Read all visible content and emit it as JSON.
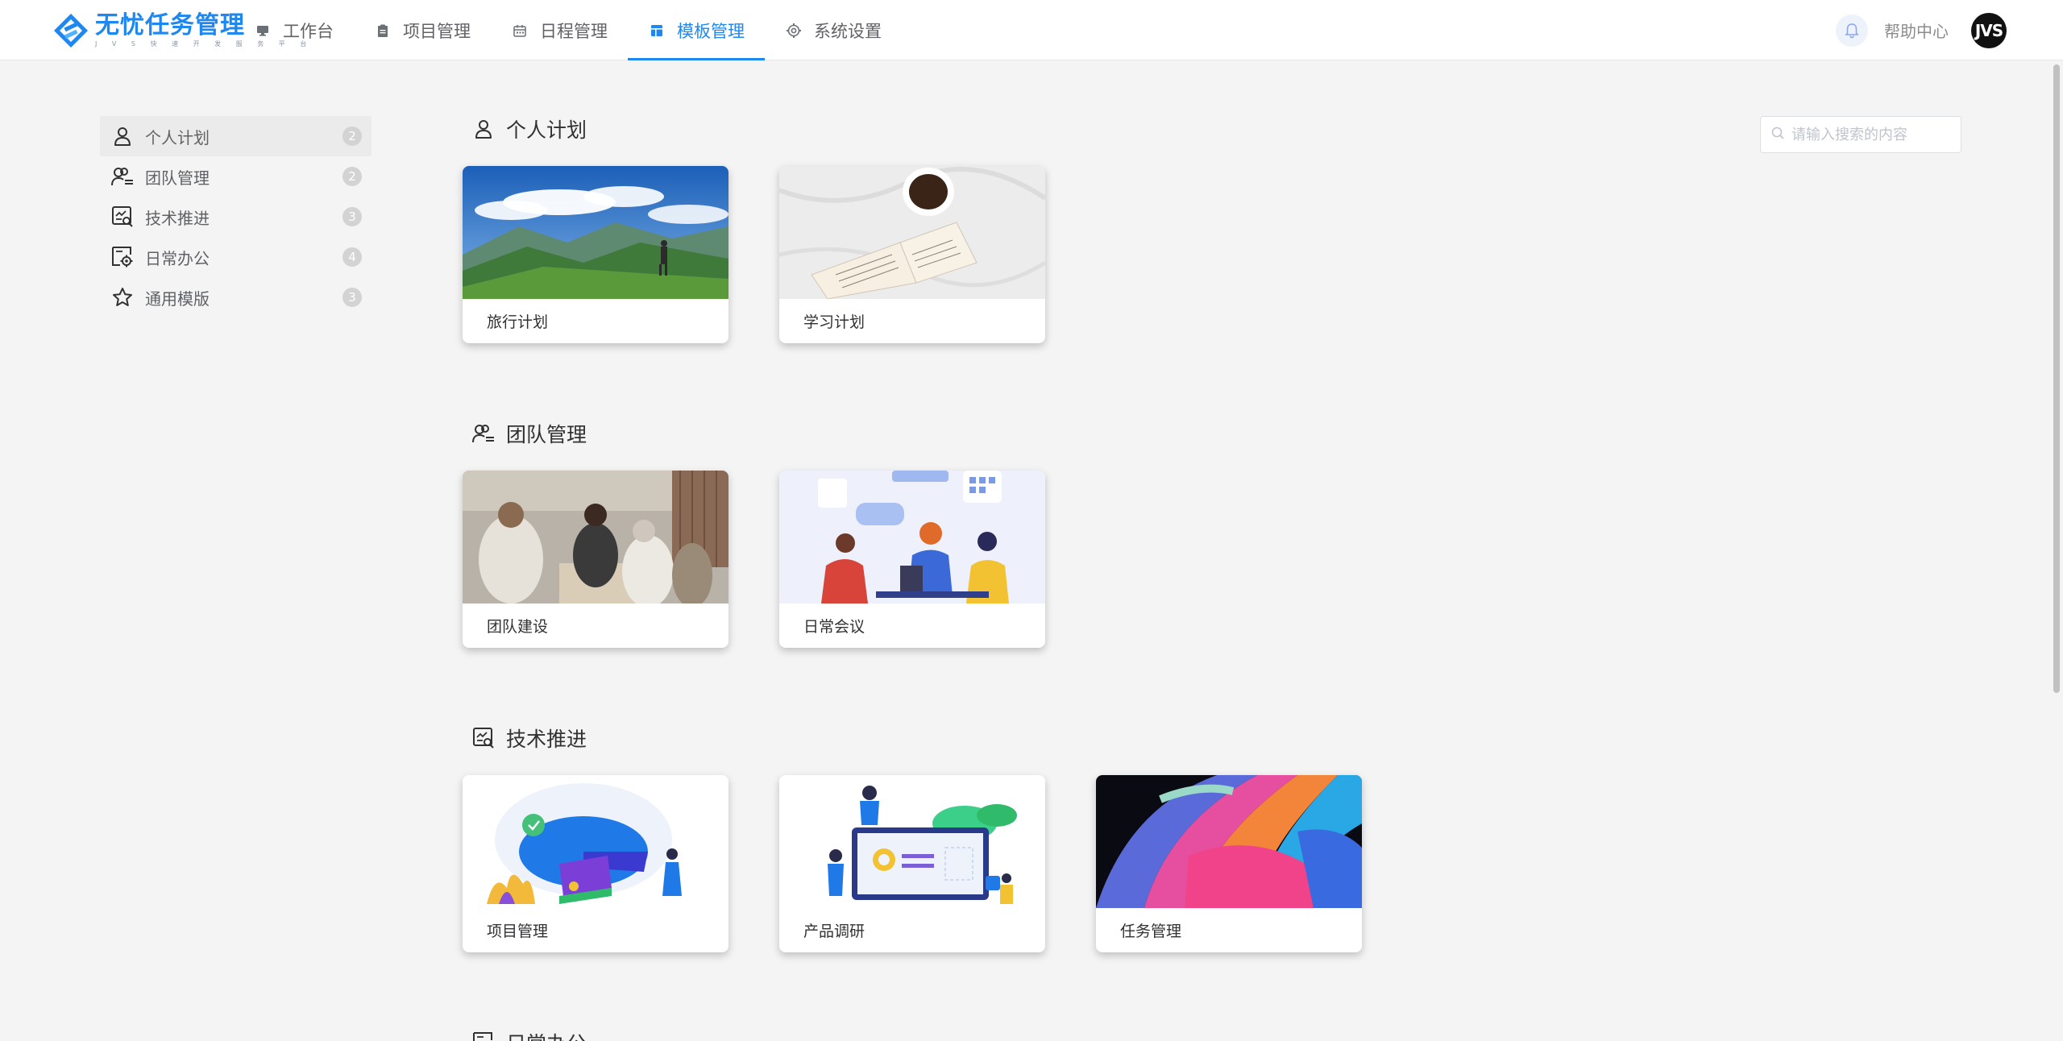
{
  "app": {
    "logo_title": "无忧任务管理",
    "logo_sub": "J V S 快 速 开 发 服 务 平 台"
  },
  "nav": [
    {
      "label": "工作台",
      "icon": "monitor-icon",
      "active": false
    },
    {
      "label": "项目管理",
      "icon": "clipboard-icon",
      "active": false
    },
    {
      "label": "日程管理",
      "icon": "calendar-icon",
      "active": false
    },
    {
      "label": "模板管理",
      "icon": "template-icon",
      "active": true
    },
    {
      "label": "系统设置",
      "icon": "gear-icon",
      "active": false
    }
  ],
  "header_right": {
    "help": "帮助中心",
    "avatar": "JVS"
  },
  "sidebar": {
    "items": [
      {
        "label": "个人计划",
        "count": "2",
        "icon": "person-icon",
        "active": true
      },
      {
        "label": "团队管理",
        "count": "2",
        "icon": "team-icon",
        "active": false
      },
      {
        "label": "技术推进",
        "count": "3",
        "icon": "tech-icon",
        "active": false
      },
      {
        "label": "日常办公",
        "count": "4",
        "icon": "office-icon",
        "active": false
      },
      {
        "label": "通用模版",
        "count": "3",
        "icon": "star-icon",
        "active": false
      }
    ]
  },
  "search": {
    "placeholder": "请输入搜索的内容"
  },
  "sections": [
    {
      "title": "个人计划",
      "icon": "person-icon",
      "cards": [
        {
          "label": "旅行计划"
        },
        {
          "label": "学习计划"
        }
      ]
    },
    {
      "title": "团队管理",
      "icon": "team-icon",
      "cards": [
        {
          "label": "团队建设"
        },
        {
          "label": "日常会议"
        }
      ]
    },
    {
      "title": "技术推进",
      "icon": "tech-icon",
      "cards": [
        {
          "label": "项目管理"
        },
        {
          "label": "产品调研"
        },
        {
          "label": "任务管理"
        }
      ]
    },
    {
      "title": "日常办公",
      "icon": "office-icon",
      "cards": []
    }
  ]
}
